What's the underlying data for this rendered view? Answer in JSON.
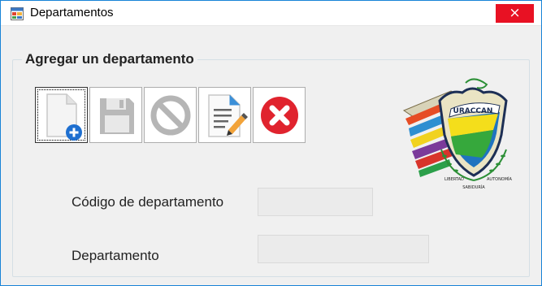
{
  "window": {
    "title": "Departamentos",
    "close_glyph": "×"
  },
  "group": {
    "title": "Agregar un departamento"
  },
  "toolbar": {
    "buttons": [
      {
        "name": "new-document-icon",
        "enabled": true
      },
      {
        "name": "save-icon",
        "enabled": false
      },
      {
        "name": "cancel-icon",
        "enabled": false
      },
      {
        "name": "edit-icon",
        "enabled": true
      },
      {
        "name": "delete-icon",
        "enabled": true
      }
    ]
  },
  "logo": {
    "banner": "URACCAN",
    "motto_left": "LIBERTAD",
    "motto_right": "AUTONOMÍA",
    "motto_bottom": "SABIDURÍA"
  },
  "form": {
    "code_label": "Código de departamento",
    "code_value": "",
    "dept_label": "Departamento",
    "dept_value": ""
  },
  "colors": {
    "close_bg": "#e81123",
    "window_border": "#1883d7",
    "form_bg": "#f0f0f0",
    "delete_red": "#e0232e"
  }
}
